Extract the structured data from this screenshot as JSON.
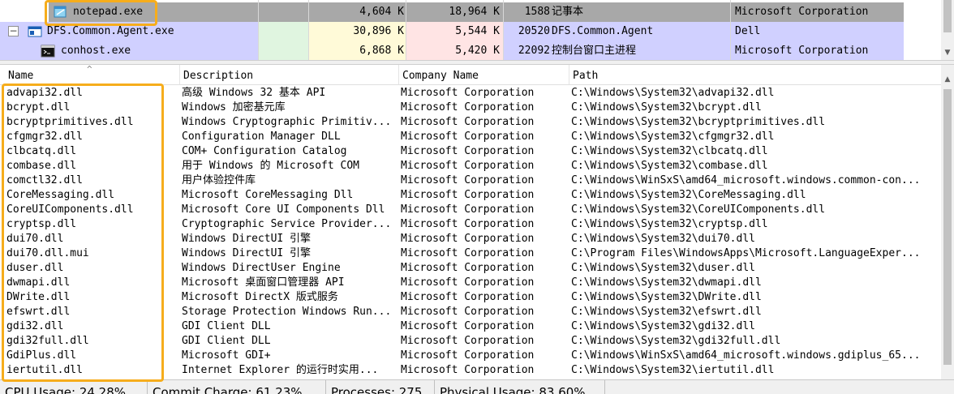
{
  "processes": [
    {
      "name": "notepad.exe",
      "private_bytes": "4,604 K",
      "working_set": "18,964 K",
      "pid": "1588",
      "description": "记事本",
      "company": "Microsoft Corporation",
      "selected": true
    },
    {
      "name": "DFS.Common.Agent.exe",
      "private_bytes": "30,896 K",
      "working_set": "5,544 K",
      "pid": "20520",
      "description": "DFS.Common.Agent",
      "company": "Dell",
      "selected": false
    },
    {
      "name": "conhost.exe",
      "private_bytes": "6,868 K",
      "working_set": "5,420 K",
      "pid": "22092",
      "description": "控制台窗口主进程",
      "company": "Microsoft Corporation",
      "selected": false
    }
  ],
  "tree_toggle": "−",
  "dll_list": {
    "headers": {
      "name": "Name",
      "description": "Description",
      "company": "Company Name",
      "path": "Path"
    },
    "sort_indicator": "^",
    "rows": [
      {
        "name": "advapi32.dll",
        "description": "高级 Windows 32 基本 API",
        "company": "Microsoft Corporation",
        "path": "C:\\Windows\\System32\\advapi32.dll"
      },
      {
        "name": "bcrypt.dll",
        "description": "Windows 加密基元库",
        "company": "Microsoft Corporation",
        "path": "C:\\Windows\\System32\\bcrypt.dll"
      },
      {
        "name": "bcryptprimitives.dll",
        "description": "Windows Cryptographic Primitiv...",
        "company": "Microsoft Corporation",
        "path": "C:\\Windows\\System32\\bcryptprimitives.dll"
      },
      {
        "name": "cfgmgr32.dll",
        "description": "Configuration Manager DLL",
        "company": "Microsoft Corporation",
        "path": "C:\\Windows\\System32\\cfgmgr32.dll"
      },
      {
        "name": "clbcatq.dll",
        "description": "COM+ Configuration Catalog",
        "company": "Microsoft Corporation",
        "path": "C:\\Windows\\System32\\clbcatq.dll"
      },
      {
        "name": "combase.dll",
        "description": "用于 Windows 的 Microsoft COM",
        "company": "Microsoft Corporation",
        "path": "C:\\Windows\\System32\\combase.dll"
      },
      {
        "name": "comctl32.dll",
        "description": "用户体验控件库",
        "company": "Microsoft Corporation",
        "path": "C:\\Windows\\WinSxS\\amd64_microsoft.windows.common-con..."
      },
      {
        "name": "CoreMessaging.dll",
        "description": "Microsoft CoreMessaging Dll",
        "company": "Microsoft Corporation",
        "path": "C:\\Windows\\System32\\CoreMessaging.dll"
      },
      {
        "name": "CoreUIComponents.dll",
        "description": "Microsoft Core UI Components Dll",
        "company": "Microsoft Corporation",
        "path": "C:\\Windows\\System32\\CoreUIComponents.dll"
      },
      {
        "name": "cryptsp.dll",
        "description": "Cryptographic Service Provider...",
        "company": "Microsoft Corporation",
        "path": "C:\\Windows\\System32\\cryptsp.dll"
      },
      {
        "name": "dui70.dll",
        "description": "Windows DirectUI 引擎",
        "company": "Microsoft Corporation",
        "path": "C:\\Windows\\System32\\dui70.dll"
      },
      {
        "name": "dui70.dll.mui",
        "description": "Windows DirectUI 引擎",
        "company": "Microsoft Corporation",
        "path": "C:\\Program Files\\WindowsApps\\Microsoft.LanguageExper..."
      },
      {
        "name": "duser.dll",
        "description": "Windows DirectUser Engine",
        "company": "Microsoft Corporation",
        "path": "C:\\Windows\\System32\\duser.dll"
      },
      {
        "name": "dwmapi.dll",
        "description": "Microsoft 桌面窗口管理器 API",
        "company": "Microsoft Corporation",
        "path": "C:\\Windows\\System32\\dwmapi.dll"
      },
      {
        "name": "DWrite.dll",
        "description": "Microsoft DirectX 版式服务",
        "company": "Microsoft Corporation",
        "path": "C:\\Windows\\System32\\DWrite.dll"
      },
      {
        "name": "efswrt.dll",
        "description": "Storage Protection Windows Run...",
        "company": "Microsoft Corporation",
        "path": "C:\\Windows\\System32\\efswrt.dll"
      },
      {
        "name": "gdi32.dll",
        "description": "GDI Client DLL",
        "company": "Microsoft Corporation",
        "path": "C:\\Windows\\System32\\gdi32.dll"
      },
      {
        "name": "gdi32full.dll",
        "description": "GDI Client DLL",
        "company": "Microsoft Corporation",
        "path": "C:\\Windows\\System32\\gdi32full.dll"
      },
      {
        "name": "GdiPlus.dll",
        "description": "Microsoft GDI+",
        "company": "Microsoft Corporation",
        "path": "C:\\Windows\\WinSxS\\amd64_microsoft.windows.gdiplus_65..."
      },
      {
        "name": "iertutil.dll",
        "description": "Internet Explorer 的运行时实用...",
        "company": "Microsoft Corporation",
        "path": "C:\\Windows\\System32\\iertutil.dll"
      }
    ]
  },
  "status_bar": {
    "cpu": "CPU Usage: 24.28%",
    "commit": "Commit Charge: 61.23%",
    "processes": "Processes: 275",
    "physical": "Physical Usage: 83.60%"
  },
  "colors": {
    "selected_row": "#a8a8a8",
    "service_row": "#d0d0ff",
    "highlight_box": "#f6ad1c",
    "scroll_thumb": "#c2c2c2"
  },
  "icons": {
    "notepad": "notepad-icon",
    "dfs": "application-window-icon",
    "conhost": "console-icon"
  }
}
